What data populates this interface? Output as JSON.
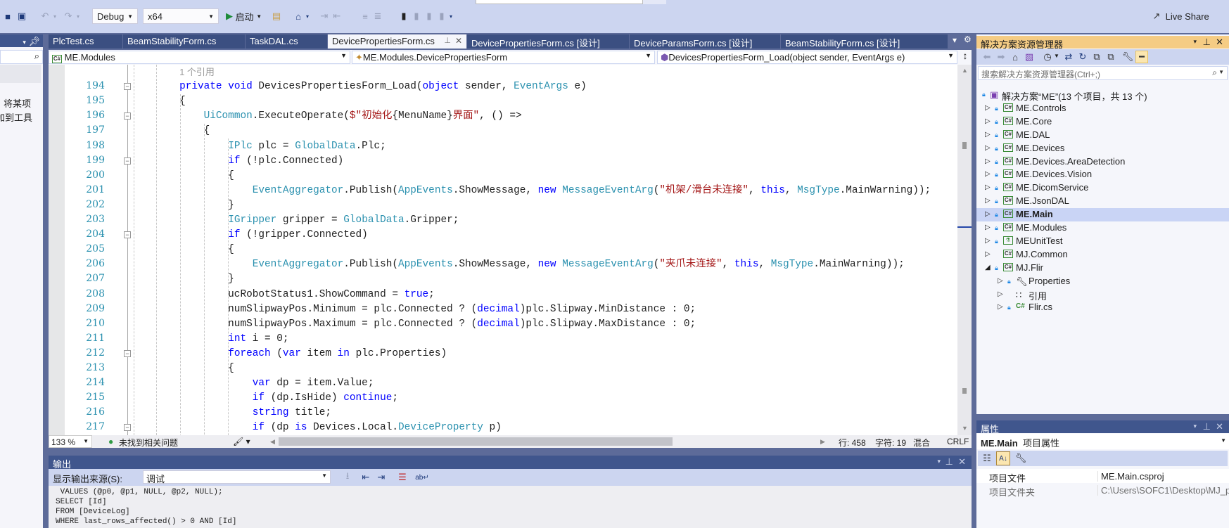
{
  "toolbar": {
    "config": "Debug",
    "platform": "x64",
    "start_label": "启动",
    "live_share": "Live Share"
  },
  "left_panel": {
    "text_lines": [
      "，将某项",
      "加到工具"
    ]
  },
  "tabs": [
    {
      "label": "PlcTest.cs",
      "active": false
    },
    {
      "label": "BeamStabilityForm.cs",
      "active": false
    },
    {
      "label": "TaskDAL.cs",
      "active": false
    },
    {
      "label": "DevicePropertiesForm.cs",
      "active": true
    },
    {
      "label": "DevicePropertiesForm.cs [设计]",
      "active": false
    },
    {
      "label": "DeviceParamsForm.cs [设计]",
      "active": false
    },
    {
      "label": "BeamStabilityForm.cs [设计]",
      "active": false
    }
  ],
  "navbar": {
    "project": "ME.Modules",
    "type": "ME.Modules.DevicePropertiesForm",
    "member": "DevicesPropertiesForm_Load(object sender, EventArgs e)"
  },
  "code": {
    "reference_hint": "1 个引用",
    "lines": [
      {
        "n": "194",
        "fold": true,
        "tokens": [
          [
            "        ",
            "p"
          ],
          [
            "private",
            "k"
          ],
          [
            " ",
            "p"
          ],
          [
            "void",
            "k"
          ],
          [
            " DevicesPropertiesForm_Load(",
            "p"
          ],
          [
            "object",
            "k"
          ],
          [
            " sender, ",
            "p"
          ],
          [
            "EventArgs",
            "t"
          ],
          [
            " e)",
            "p"
          ]
        ]
      },
      {
        "n": "195",
        "fold": false,
        "tokens": [
          [
            "        {",
            "p"
          ]
        ]
      },
      {
        "n": "196",
        "fold": true,
        "tokens": [
          [
            "            ",
            "p"
          ],
          [
            "UiCommon",
            "t"
          ],
          [
            ".ExecuteOperate(",
            "p"
          ],
          [
            "$\"初始化",
            "s"
          ],
          [
            "{MenuName}",
            "p"
          ],
          [
            "界面\"",
            "s"
          ],
          [
            ", () =>",
            "p"
          ]
        ]
      },
      {
        "n": "197",
        "fold": false,
        "tokens": [
          [
            "            {",
            "p"
          ]
        ]
      },
      {
        "n": "198",
        "fold": false,
        "tokens": [
          [
            "                ",
            "p"
          ],
          [
            "IPlc",
            "t"
          ],
          [
            " plc = ",
            "p"
          ],
          [
            "GlobalData",
            "t"
          ],
          [
            ".Plc;",
            "p"
          ]
        ]
      },
      {
        "n": "199",
        "fold": true,
        "tokens": [
          [
            "                ",
            "p"
          ],
          [
            "if",
            "k"
          ],
          [
            " (!plc.Connected)",
            "p"
          ]
        ]
      },
      {
        "n": "200",
        "fold": false,
        "tokens": [
          [
            "                {",
            "p"
          ]
        ]
      },
      {
        "n": "201",
        "fold": false,
        "tokens": [
          [
            "                    ",
            "p"
          ],
          [
            "EventAggregator",
            "t"
          ],
          [
            ".Publish(",
            "p"
          ],
          [
            "AppEvents",
            "t"
          ],
          [
            ".ShowMessage, ",
            "p"
          ],
          [
            "new",
            "k"
          ],
          [
            " ",
            "p"
          ],
          [
            "MessageEventArg",
            "t"
          ],
          [
            "(",
            "p"
          ],
          [
            "\"机架/滑台未连接\"",
            "s"
          ],
          [
            ", ",
            "p"
          ],
          [
            "this",
            "k"
          ],
          [
            ", ",
            "p"
          ],
          [
            "MsgType",
            "t"
          ],
          [
            ".MainWarning));",
            "p"
          ]
        ]
      },
      {
        "n": "202",
        "fold": false,
        "tokens": [
          [
            "                }",
            "p"
          ]
        ]
      },
      {
        "n": "203",
        "fold": false,
        "tokens": [
          [
            "                ",
            "p"
          ],
          [
            "IGripper",
            "t"
          ],
          [
            " gripper = ",
            "p"
          ],
          [
            "GlobalData",
            "t"
          ],
          [
            ".Gripper;",
            "p"
          ]
        ]
      },
      {
        "n": "204",
        "fold": true,
        "tokens": [
          [
            "                ",
            "p"
          ],
          [
            "if",
            "k"
          ],
          [
            " (!gripper.Connected)",
            "p"
          ]
        ]
      },
      {
        "n": "205",
        "fold": false,
        "tokens": [
          [
            "                {",
            "p"
          ]
        ]
      },
      {
        "n": "206",
        "fold": false,
        "tokens": [
          [
            "                    ",
            "p"
          ],
          [
            "EventAggregator",
            "t"
          ],
          [
            ".Publish(",
            "p"
          ],
          [
            "AppEvents",
            "t"
          ],
          [
            ".ShowMessage, ",
            "p"
          ],
          [
            "new",
            "k"
          ],
          [
            " ",
            "p"
          ],
          [
            "MessageEventArg",
            "t"
          ],
          [
            "(",
            "p"
          ],
          [
            "\"夹爪未连接\"",
            "s"
          ],
          [
            ", ",
            "p"
          ],
          [
            "this",
            "k"
          ],
          [
            ", ",
            "p"
          ],
          [
            "MsgType",
            "t"
          ],
          [
            ".MainWarning));",
            "p"
          ]
        ]
      },
      {
        "n": "207",
        "fold": false,
        "tokens": [
          [
            "                }",
            "p"
          ]
        ]
      },
      {
        "n": "208",
        "fold": false,
        "tokens": [
          [
            "                ucRobotStatus1.ShowCommand = ",
            "p"
          ],
          [
            "true",
            "k"
          ],
          [
            ";",
            "p"
          ]
        ]
      },
      {
        "n": "209",
        "fold": false,
        "tokens": [
          [
            "                numSlipwayPos.Minimum = plc.Connected ? (",
            "p"
          ],
          [
            "decimal",
            "k"
          ],
          [
            ")plc.Slipway.MinDistance : 0;",
            "p"
          ]
        ]
      },
      {
        "n": "210",
        "fold": false,
        "tokens": [
          [
            "                numSlipwayPos.Maximum = plc.Connected ? (",
            "p"
          ],
          [
            "decimal",
            "k"
          ],
          [
            ")plc.Slipway.MaxDistance : 0;",
            "p"
          ]
        ]
      },
      {
        "n": "211",
        "fold": false,
        "tokens": [
          [
            "                ",
            "p"
          ],
          [
            "int",
            "k"
          ],
          [
            " i = 0;",
            "p"
          ]
        ]
      },
      {
        "n": "212",
        "fold": true,
        "tokens": [
          [
            "                ",
            "p"
          ],
          [
            "foreach",
            "k"
          ],
          [
            " (",
            "p"
          ],
          [
            "var",
            "k"
          ],
          [
            " item ",
            "p"
          ],
          [
            "in",
            "k"
          ],
          [
            " plc.Properties)",
            "p"
          ]
        ]
      },
      {
        "n": "213",
        "fold": false,
        "tokens": [
          [
            "                {",
            "p"
          ]
        ]
      },
      {
        "n": "214",
        "fold": false,
        "tokens": [
          [
            "                    ",
            "p"
          ],
          [
            "var",
            "k"
          ],
          [
            " dp = item.Value;",
            "p"
          ]
        ]
      },
      {
        "n": "215",
        "fold": false,
        "tokens": [
          [
            "                    ",
            "p"
          ],
          [
            "if",
            "k"
          ],
          [
            " (dp.IsHide) ",
            "p"
          ],
          [
            "continue",
            "k"
          ],
          [
            ";",
            "p"
          ]
        ]
      },
      {
        "n": "216",
        "fold": false,
        "tokens": [
          [
            "                    ",
            "p"
          ],
          [
            "string",
            "k"
          ],
          [
            " title;",
            "p"
          ]
        ]
      },
      {
        "n": "217",
        "fold": true,
        "tokens": [
          [
            "                    ",
            "p"
          ],
          [
            "if",
            "k"
          ],
          [
            " (dp ",
            "p"
          ],
          [
            "is",
            "k"
          ],
          [
            " Devices.Local.",
            "p"
          ],
          [
            "DeviceProperty",
            "t"
          ],
          [
            " p)",
            "p"
          ]
        ]
      }
    ]
  },
  "editor_status": {
    "zoom": "133 %",
    "issues": "未找到相关问题",
    "line": "行: 458",
    "char": "字符: 19",
    "tabs_mode": "混合",
    "eol": "CRLF"
  },
  "output": {
    "title": "输出",
    "source_label": "显示输出来源(S):",
    "source_value": "调试",
    "lines": [
      " VALUES (@p0, @p1, NULL, @p2, NULL);",
      "SELECT [Id]",
      "FROM [DeviceLog]",
      "WHERE last_rows_affected() > 0 AND [Id]"
    ]
  },
  "solution_explorer": {
    "title": "解决方案资源管理器",
    "search_placeholder": "搜索解决方案资源管理器(Ctrl+;)",
    "root": "解决方案“ME”(13 个项目，共 13 个)",
    "items": [
      {
        "label": "ME.Controls",
        "level": 1,
        "icon": "csharp-project-icon",
        "locked": true,
        "expanded": false,
        "selected": false
      },
      {
        "label": "ME.Core",
        "level": 1,
        "icon": "csharp-project-icon",
        "locked": true,
        "expanded": false,
        "selected": false
      },
      {
        "label": "ME.DAL",
        "level": 1,
        "icon": "csharp-project-icon",
        "locked": true,
        "expanded": false,
        "selected": false
      },
      {
        "label": "ME.Devices",
        "level": 1,
        "icon": "csharp-project-icon",
        "locked": true,
        "expanded": false,
        "selected": false
      },
      {
        "label": "ME.Devices.AreaDetection",
        "level": 1,
        "icon": "csharp-project-icon",
        "locked": true,
        "expanded": false,
        "selected": false
      },
      {
        "label": "ME.Devices.Vision",
        "level": 1,
        "icon": "csharp-project-icon",
        "locked": true,
        "expanded": false,
        "selected": false
      },
      {
        "label": "ME.DicomService",
        "level": 1,
        "icon": "csharp-project-icon",
        "locked": true,
        "expanded": false,
        "selected": false
      },
      {
        "label": "ME.JsonDAL",
        "level": 1,
        "icon": "csharp-project-icon",
        "locked": true,
        "expanded": false,
        "selected": false
      },
      {
        "label": "ME.Main",
        "level": 1,
        "icon": "csharp-project-icon",
        "locked": true,
        "expanded": false,
        "selected": true
      },
      {
        "label": "ME.Modules",
        "level": 1,
        "icon": "csharp-project-icon",
        "locked": true,
        "expanded": false,
        "selected": false
      },
      {
        "label": "MEUnitTest",
        "level": 1,
        "icon": "test-project-icon",
        "locked": true,
        "expanded": false,
        "selected": false
      },
      {
        "label": "MJ.Common",
        "level": 1,
        "icon": "csharp-project-icon",
        "locked": false,
        "expanded": false,
        "selected": false
      },
      {
        "label": "MJ.Flir",
        "level": 1,
        "icon": "csharp-project-icon",
        "locked": true,
        "expanded": true,
        "selected": false
      },
      {
        "label": "Properties",
        "level": 2,
        "icon": "wrench-icon",
        "locked": true,
        "expanded": false,
        "selected": false
      },
      {
        "label": "引用",
        "level": 2,
        "icon": "references-icon",
        "locked": false,
        "expanded": false,
        "selected": false
      },
      {
        "label": "Flir.cs",
        "level": 2,
        "icon": "csharp-file-icon",
        "locked": true,
        "expanded": false,
        "selected": false
      }
    ]
  },
  "properties": {
    "title": "属性",
    "object_name": "ME.Main",
    "object_type": "项目属性",
    "rows": [
      {
        "name": "项目文件",
        "value": "ME.Main.csproj"
      },
      {
        "name": "项目文件夹",
        "value": "C:\\Users\\SOFC1\\Desktop\\MJ_p"
      }
    ]
  },
  "colors": {
    "frame": "#5d6b99",
    "tool_window_header": "#40568d",
    "active_header": "#f5cc84",
    "keyword": "#0000ff",
    "type": "#2b91af",
    "string": "#a31515",
    "line_number": "#2b91af",
    "selection": "#c9d4f5"
  }
}
